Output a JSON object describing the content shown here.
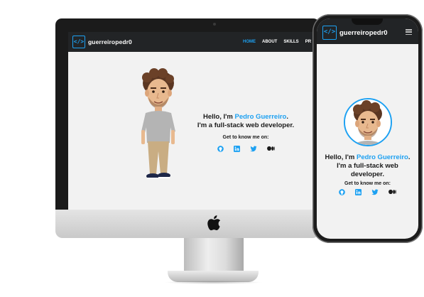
{
  "site": {
    "logo_glyph": "</>",
    "logo_text": "guerreiropedr0",
    "brand_color": "#1da1f2",
    "nav_background": "#222426",
    "page_background": "#f2f2f2"
  },
  "desktop": {
    "nav": {
      "items": [
        "HOME",
        "ABOUT",
        "SKILLS",
        "PR"
      ],
      "active_item": "HOME"
    },
    "hero": {
      "greeting": "Hello, I'm ",
      "name": "Pedro Guerreiro",
      "greeting_end": ".",
      "tagline": "I'm a full-stack web developer.",
      "social_prompt": "Get to know me on:"
    },
    "social_icons": [
      "github-icon",
      "linkedin-icon",
      "twitter-icon",
      "medium-icon"
    ]
  },
  "mobile": {
    "nav": {
      "menu_icon": "hamburger-icon"
    },
    "hero": {
      "greeting": "Hello, I'm ",
      "name": "Pedro Guerreiro",
      "tagline": ". I'm a full-stack web developer.",
      "social_prompt": "Get to know me on:"
    },
    "social_icons": [
      "github-icon",
      "linkedin-icon",
      "twitter-icon",
      "medium-icon"
    ]
  },
  "device": {
    "monitor_logo": "apple-logo-icon"
  }
}
